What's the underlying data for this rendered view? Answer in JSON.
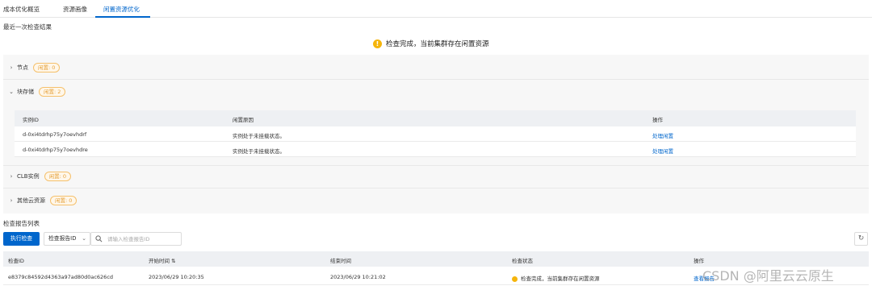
{
  "tabs": [
    {
      "label": "成本优化概览"
    },
    {
      "label": "资源画像"
    },
    {
      "label": "闲置资源优化"
    }
  ],
  "active_tab_index": 2,
  "last_check": {
    "title": "最近一次检查结果",
    "status_text": "检查完成，当前集群存在闲置资源",
    "status_color": "#f5b50c"
  },
  "categories": [
    {
      "name": "节点",
      "badge": "闲置: 0",
      "expanded": false
    },
    {
      "name": "块存储",
      "badge": "闲置: 2",
      "expanded": true
    },
    {
      "name": "CLB实例",
      "badge": "闲置: 0",
      "expanded": false
    },
    {
      "name": "其他云资源",
      "badge": "闲置: 0",
      "expanded": false
    }
  ],
  "storage_table": {
    "headers": [
      "实例ID",
      "闲置原因",
      "操作"
    ],
    "rows": [
      {
        "id": "d-0xi4tdrhp75y7oevhdrf",
        "reason": "实例处于未挂载状态。",
        "action": "处理闲置"
      },
      {
        "id": "d-0xi4tdrhp75y7oevhdre",
        "reason": "实例处于未挂载状态。",
        "action": "处理闲置"
      }
    ]
  },
  "report_list": {
    "title": "检查报告列表",
    "run_button": "执行检查",
    "filter_select": "检查报告ID",
    "search_placeholder": "请输入检查报告ID",
    "headers": [
      "检查ID",
      "开始时间",
      "结束时间",
      "检查状态",
      "操作"
    ],
    "sort_glyph": "⇅",
    "rows": [
      {
        "id": "e8379c84592d4363a97ad80d0ac626cd",
        "start": "2023/06/29 10:20:35",
        "end": "2023/06/29 10:21:02",
        "status": "检查完成，当前集群存在闲置资源",
        "action": "查看报告"
      }
    ]
  },
  "watermark": "CSDN @阿里云云原生",
  "colors": {
    "primary": "#0066cc",
    "warning": "#f5b50c",
    "badge_border": "#f5c06b"
  }
}
